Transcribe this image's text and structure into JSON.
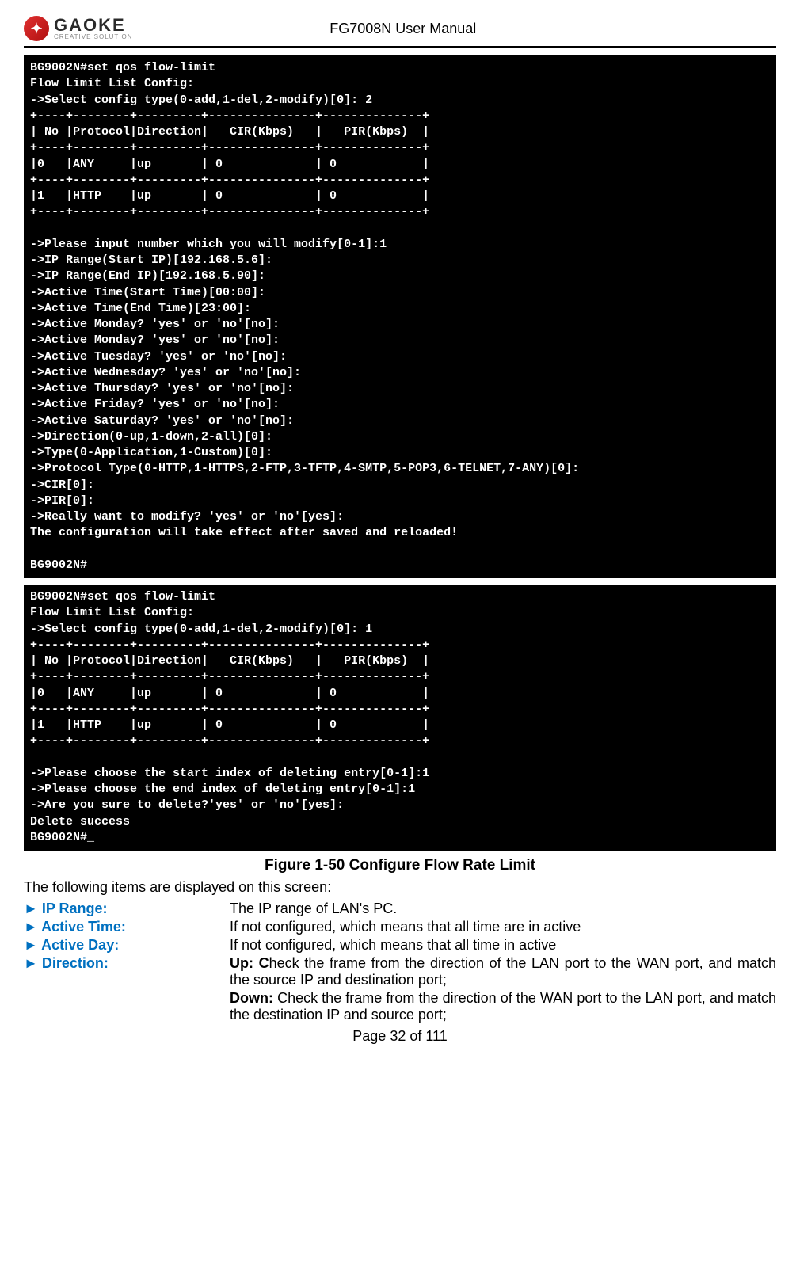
{
  "header": {
    "logo_text": "GAOKE",
    "logo_subtext": "CREATIVE SOLUTION",
    "manual_title": "FG7008N User Manual"
  },
  "terminal_modify": "BG9002N#set qos flow-limit\nFlow Limit List Config:\n->Select config type(0-add,1-del,2-modify)[0]: 2\n+----+--------+---------+---------------+--------------+\n| No |Protocol|Direction|   CIR(Kbps)   |   PIR(Kbps)  |\n+----+--------+---------+---------------+--------------+\n|0   |ANY     |up       | 0             | 0            |\n+----+--------+---------+---------------+--------------+\n|1   |HTTP    |up       | 0             | 0            |\n+----+--------+---------+---------------+--------------+\n\n->Please input number which you will modify[0-1]:1\n->IP Range(Start IP)[192.168.5.6]:\n->IP Range(End IP)[192.168.5.90]:\n->Active Time(Start Time)[00:00]:\n->Active Time(End Time)[23:00]:\n->Active Monday? 'yes' or 'no'[no]:\n->Active Monday? 'yes' or 'no'[no]:\n->Active Tuesday? 'yes' or 'no'[no]:\n->Active Wednesday? 'yes' or 'no'[no]:\n->Active Thursday? 'yes' or 'no'[no]:\n->Active Friday? 'yes' or 'no'[no]:\n->Active Saturday? 'yes' or 'no'[no]:\n->Direction(0-up,1-down,2-all)[0]:\n->Type(0-Application,1-Custom)[0]:\n->Protocol Type(0-HTTP,1-HTTPS,2-FTP,3-TFTP,4-SMTP,5-POP3,6-TELNET,7-ANY)[0]:\n->CIR[0]:\n->PIR[0]:\n->Really want to modify? 'yes' or 'no'[yes]:\nThe configuration will take effect after saved and reloaded!\n\nBG9002N#",
  "terminal_delete": "BG9002N#set qos flow-limit\nFlow Limit List Config:\n->Select config type(0-add,1-del,2-modify)[0]: 1\n+----+--------+---------+---------------+--------------+\n| No |Protocol|Direction|   CIR(Kbps)   |   PIR(Kbps)  |\n+----+--------+---------+---------------+--------------+\n|0   |ANY     |up       | 0             | 0            |\n+----+--------+---------+---------------+--------------+\n|1   |HTTP    |up       | 0             | 0            |\n+----+--------+---------+---------------+--------------+\n\n->Please choose the start index of deleting entry[0-1]:1\n->Please choose the end index of deleting entry[0-1]:1\n->Are you sure to delete?'yes' or 'no'[yes]:\nDelete success\nBG9002N#_",
  "figure_caption": "Figure 1-50    Configure Flow Rate Limit",
  "intro_text": "The following items are displayed on this screen:",
  "definitions": {
    "ip_range": {
      "label": "IP Range:",
      "text": "The IP range of LAN's PC."
    },
    "active_time": {
      "label": "Active Time:",
      "text": "If not configured, which means that all time are in active"
    },
    "active_day": {
      "label": "Active Day:",
      "text": "If not configured, which means that all time in active"
    },
    "direction": {
      "label": "Direction:",
      "up_prefix": "Up: C",
      "up_rest": "heck the frame from the direction of the LAN port to the WAN port, and match the source IP and destination port;",
      "down_prefix": "Down:",
      "down_rest": " Check the frame from the direction of the WAN port to the LAN port, and match the destination IP and source port;"
    }
  },
  "page_number": "Page 32 of 111"
}
